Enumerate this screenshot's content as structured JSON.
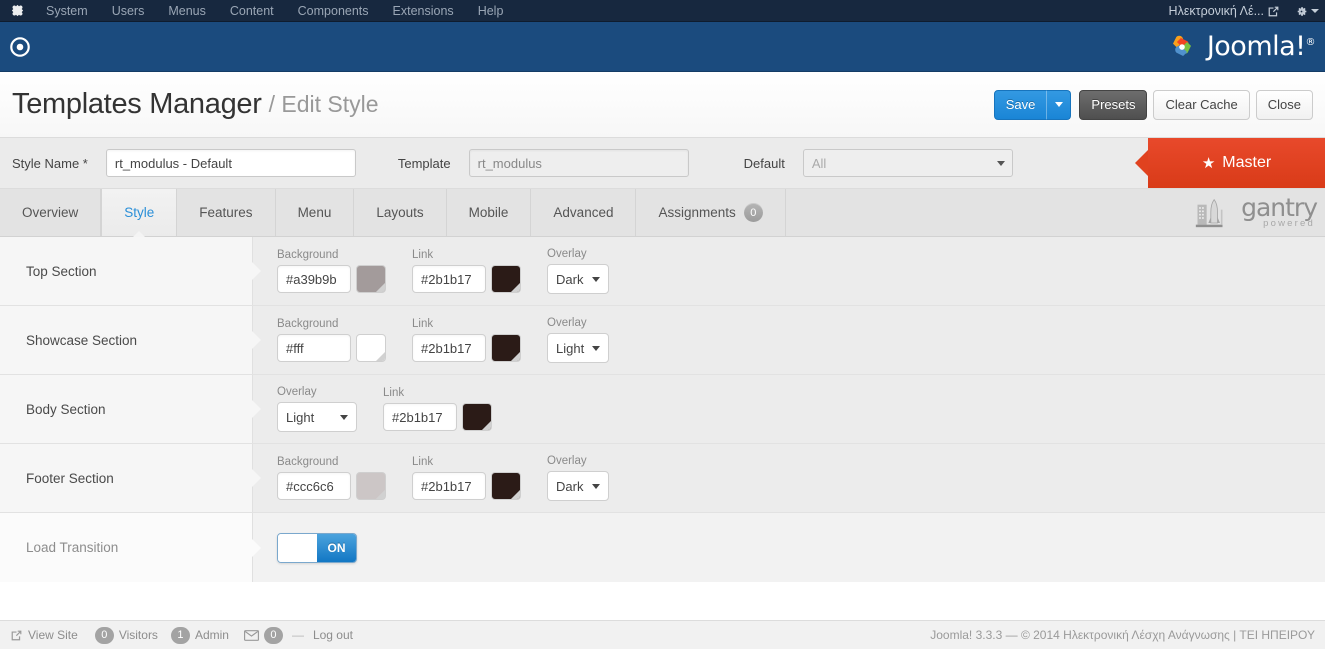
{
  "admin_bar": {
    "logo_icon": "joomla-logo-icon",
    "menu": [
      {
        "label": "System"
      },
      {
        "label": "Users"
      },
      {
        "label": "Menus"
      },
      {
        "label": "Content"
      },
      {
        "label": "Components"
      },
      {
        "label": "Extensions"
      },
      {
        "label": "Help"
      }
    ],
    "site_name": "Ηλεκτρονική Λέ...",
    "site_link_icon": "external-link-icon",
    "settings_icon": "gear-icon",
    "settings_caret_icon": "chevron-down-icon"
  },
  "blue_bar": {
    "control_panel_icon": "circle-dot-icon",
    "brand": "Joomla!",
    "brand_registered": "®",
    "brand_icon": "joomla-pinwheel-icon"
  },
  "header": {
    "title": "Templates Manager",
    "subtitle": "/ Edit Style"
  },
  "toolbar": {
    "save_label": "Save",
    "save_caret_icon": "chevron-down-icon",
    "presets_label": "Presets",
    "clear_cache_label": "Clear Cache",
    "close_label": "Close"
  },
  "style_form": {
    "style_name_label": "Style Name *",
    "style_name_value": "rt_modulus - Default",
    "template_label": "Template",
    "template_value": "rt_modulus",
    "default_label": "Default",
    "default_value": "All",
    "default_caret_icon": "chevron-down-icon",
    "master_label": "Master",
    "master_icon": "star-icon",
    "master_color": "#e0421f"
  },
  "tabs": [
    {
      "label": "Overview",
      "active": false,
      "badge": null
    },
    {
      "label": "Style",
      "active": true,
      "badge": null
    },
    {
      "label": "Features",
      "active": false,
      "badge": null
    },
    {
      "label": "Menu",
      "active": false,
      "badge": null
    },
    {
      "label": "Layouts",
      "active": false,
      "badge": null
    },
    {
      "label": "Mobile",
      "active": false,
      "badge": null
    },
    {
      "label": "Advanced",
      "active": false,
      "badge": null
    },
    {
      "label": "Assignments",
      "active": false,
      "badge": "0"
    }
  ],
  "gantry": {
    "word": "gantry",
    "sub": "powered",
    "icon": "rocket-launchpad-icon"
  },
  "sections": [
    {
      "name": "Top Section",
      "fields": [
        {
          "kind": "color",
          "label": "Background",
          "value": "#a39b9b",
          "swatch": "#a39b9b"
        },
        {
          "kind": "color",
          "label": "Link",
          "value": "#2b1b17",
          "swatch": "#2b1b17"
        },
        {
          "kind": "select",
          "label": "Overlay",
          "value": "Dark"
        }
      ]
    },
    {
      "name": "Showcase Section",
      "fields": [
        {
          "kind": "color",
          "label": "Background",
          "value": "#fff",
          "swatch": "#ffffff"
        },
        {
          "kind": "color",
          "label": "Link",
          "value": "#2b1b17",
          "swatch": "#2b1b17"
        },
        {
          "kind": "select",
          "label": "Overlay",
          "value": "Light"
        }
      ]
    },
    {
      "name": "Body Section",
      "fields": [
        {
          "kind": "select",
          "label": "Overlay",
          "value": "Light"
        },
        {
          "kind": "color",
          "label": "Link",
          "value": "#2b1b17",
          "swatch": "#2b1b17"
        }
      ]
    },
    {
      "name": "Footer Section",
      "fields": [
        {
          "kind": "color",
          "label": "Background",
          "value": "#ccc6c6",
          "swatch": "#ccc6c6"
        },
        {
          "kind": "color",
          "label": "Link",
          "value": "#2b1b17",
          "swatch": "#2b1b17"
        },
        {
          "kind": "select",
          "label": "Overlay",
          "value": "Dark"
        }
      ]
    }
  ],
  "load_transition": {
    "label": "Load Transition",
    "state": "ON"
  },
  "status_bar": {
    "view_site_label": "View Site",
    "view_site_icon": "external-link-icon",
    "visitors_count": "0",
    "visitors_label": "Visitors",
    "admin_count": "1",
    "admin_label": "Admin",
    "messages_icon": "envelope-icon",
    "messages_count": "0",
    "separator": "—",
    "logout_label": "Log out",
    "copyright": "Joomla! 3.3.3  —  © 2014 Ηλεκτρονική Λέσχη Ανάγνωσης | ΤΕΙ ΗΠΕΙΡΟΥ"
  }
}
